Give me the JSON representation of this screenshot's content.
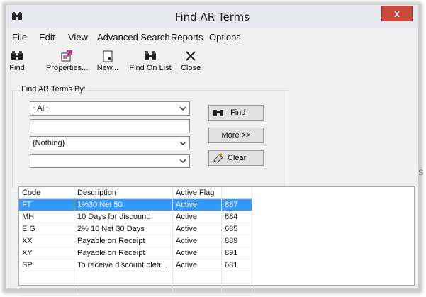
{
  "window": {
    "title": "Find AR Terms",
    "close_symbol": "x"
  },
  "menu": [
    "File",
    "Edit",
    "View",
    "Advanced Search",
    "Reports",
    "Options"
  ],
  "toolbar": [
    {
      "label": "Find",
      "icon": "binoculars-icon"
    },
    {
      "label": "Properties...",
      "icon": "properties-icon"
    },
    {
      "label": "New...",
      "icon": "new-document-icon"
    },
    {
      "label": "Find On List",
      "icon": "binoculars-icon"
    },
    {
      "label": "Close",
      "icon": "close-x-icon"
    }
  ],
  "search": {
    "group_label": "Find AR Terms By:",
    "field1": "~All~",
    "field2": "",
    "field3": "{Nothing}",
    "field4": "",
    "find_label": "Find",
    "more_label": "More >>",
    "clear_label": "Clear"
  },
  "grid": {
    "columns": [
      "Code",
      "Description",
      "Active Flag",
      ""
    ],
    "rows": [
      [
        "FT",
        "1%30 Net 50",
        "Active",
        "887"
      ],
      [
        "MH",
        "10 Days for discount:",
        "Active",
        "684"
      ],
      [
        "E G",
        "2% 10 Net 30 Days",
        "Active",
        "685"
      ],
      [
        "XX",
        "Payable on Receipt",
        "Active",
        "889"
      ],
      [
        "XY",
        "Payable on Receipt",
        "Active",
        "891"
      ],
      [
        "SP",
        "To receive discount plea...",
        "Active",
        "681"
      ]
    ],
    "selected_row": 0
  },
  "background": {
    "edge_char": "S"
  },
  "colors": {
    "close_button": "#c84a3c",
    "selection": "#3399ff"
  }
}
